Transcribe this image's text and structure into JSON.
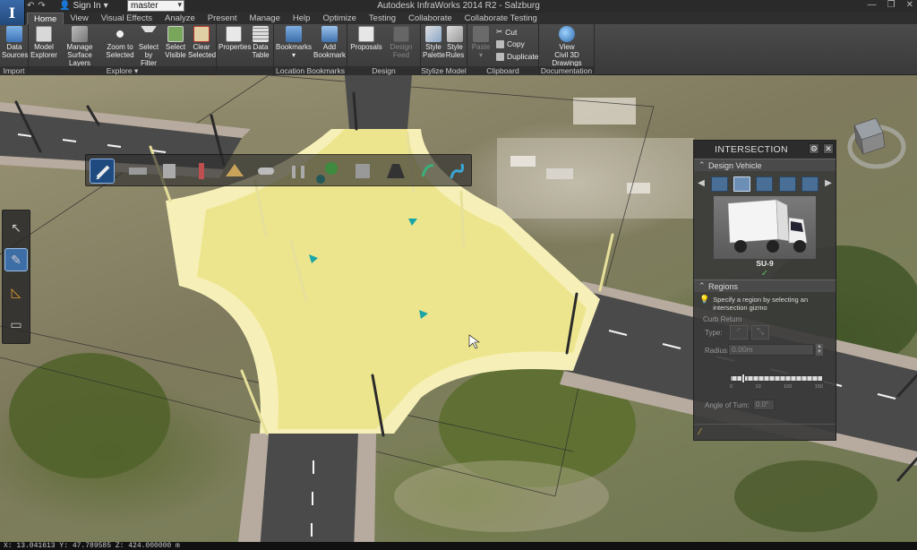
{
  "app": {
    "logo_letter": "I",
    "window_title": "Autodesk InfraWorks 2014 R2 - Salzburg",
    "sign_in_label": "Sign In",
    "model_name": "master"
  },
  "tabs": [
    {
      "label": "Home",
      "active": true
    },
    {
      "label": "View"
    },
    {
      "label": "Visual Effects"
    },
    {
      "label": "Analyze"
    },
    {
      "label": "Present"
    },
    {
      "label": "Manage"
    },
    {
      "label": "Help"
    },
    {
      "label": "Optimize"
    },
    {
      "label": "Testing"
    },
    {
      "label": "Collaborate"
    },
    {
      "label": "Collaborate Testing"
    }
  ],
  "ribbon": {
    "panels": {
      "import": "Import",
      "explore": "Explore ▾",
      "location_bookmarks": "Location Bookmarks ▾",
      "design": "Design",
      "stylize_model": "Stylize Model",
      "clipboard": "Clipboard",
      "documentation": "Documentation"
    },
    "buttons": {
      "data_sources_1": "Data",
      "data_sources_2": "Sources",
      "model_explorer_1": "Model",
      "model_explorer_2": "Explorer",
      "manage_surface_1": "Manage",
      "manage_surface_2": "Surface Layers",
      "zoom_selected_1": "Zoom to",
      "zoom_selected_2": "Selected",
      "select_filter_1": "Select by",
      "select_filter_2": "Filter",
      "select_visible_1": "Select",
      "select_visible_2": "Visible",
      "clear_selected_1": "Clear",
      "clear_selected_2": "Selected",
      "properties": "Properties",
      "data_table_1": "Data",
      "data_table_2": "Table",
      "bookmarks": "Bookmarks",
      "add_bookmark_1": "Add",
      "add_bookmark_2": "Bookmark",
      "proposals": "Proposals",
      "design_feed": "Design Feed",
      "style_palette_1": "Style",
      "style_palette_2": "Palette",
      "style_rules_1": "Style",
      "style_rules_2": "Rules",
      "paste": "Paste",
      "cut": "Cut",
      "copy": "Copy",
      "duplicate": "Duplicate",
      "view_civil3d_1": "View",
      "view_civil3d_2": "Civil 3D Drawings"
    }
  },
  "intersection_panel": {
    "title": "INTERSECTION",
    "design_vehicle_header": "Design Vehicle",
    "vehicle_name": "SU-9",
    "regions_header": "Regions",
    "hint": "Specify a region by selecting an intersection gizmo",
    "curb_return_label": "Curb Return",
    "type_label": "Type:",
    "radius_label": "Radius:",
    "radius_value": "0.00m",
    "slider_ticks": [
      "0",
      "10",
      "100",
      "150"
    ],
    "slider_value": 0.12,
    "angle_label": "Angle of Turn:",
    "angle_value": "0.0°"
  },
  "status_bar": "X: 13.041613  Y: 47.789585  Z: 424.000000 m",
  "colors": {
    "accent": "#3e6ea6",
    "road_yellow": "#f0e79a",
    "asphalt": "#4a4a4a",
    "marker_teal": "#1aa6a6"
  }
}
